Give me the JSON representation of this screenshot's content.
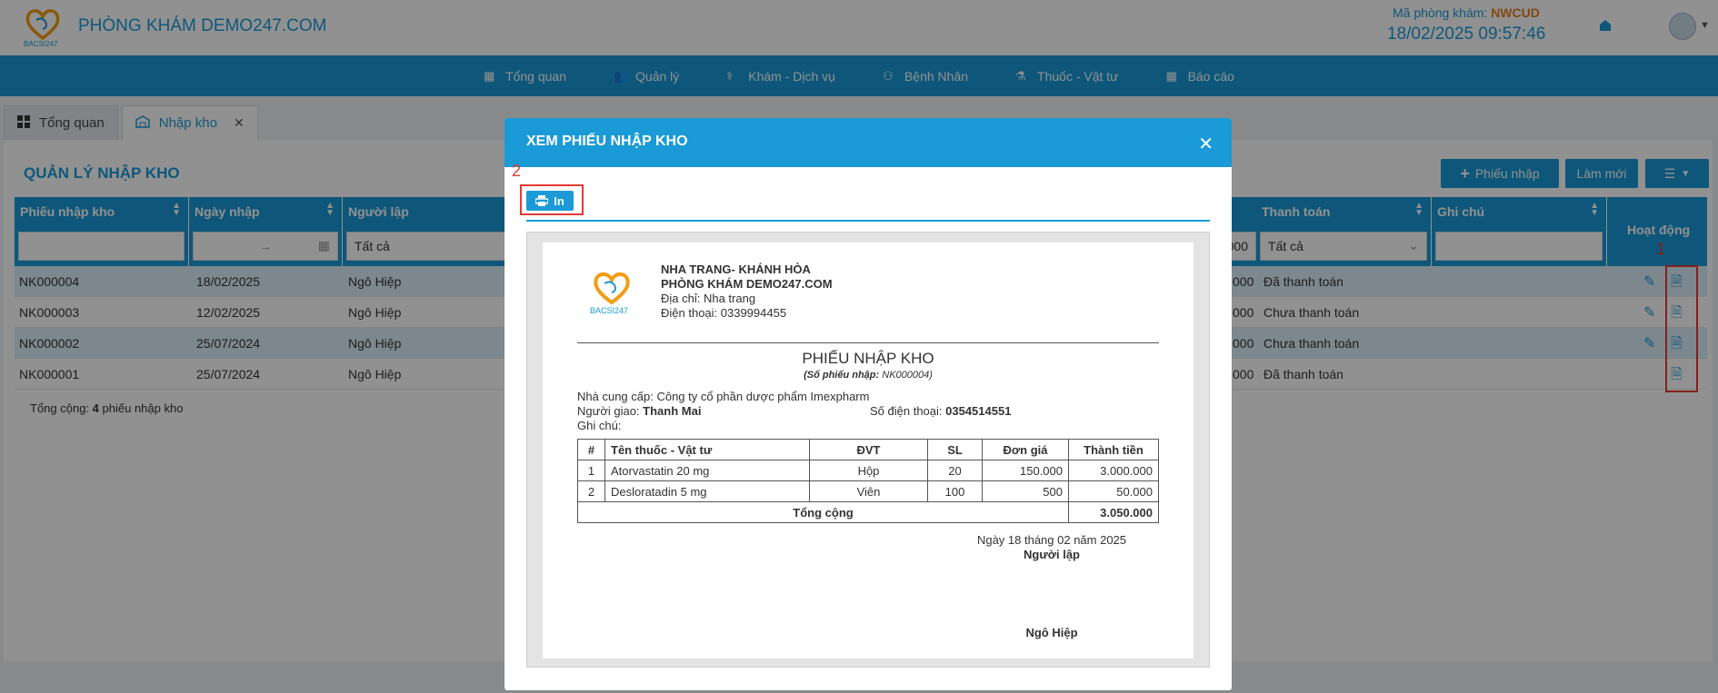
{
  "header": {
    "clinic_name": "PHÒNG KHÁM DEMO247.COM",
    "code_label": "Mã phòng khám:",
    "code_value": "NWCUD",
    "datetime": "18/02/2025 09:57:46",
    "logo_text": "BACSI247"
  },
  "nav": [
    {
      "label": "Tổng quan",
      "icon": "dashboard-icon"
    },
    {
      "label": "Quản lý",
      "icon": "users-icon"
    },
    {
      "label": "Khám - Dịch vụ",
      "icon": "doctor-icon"
    },
    {
      "label": "Bệnh Nhân",
      "icon": "patient-icon"
    },
    {
      "label": "Thuốc - Vật tư",
      "icon": "medicine-icon"
    },
    {
      "label": "Báo cáo",
      "icon": "report-icon"
    }
  ],
  "tabs": [
    {
      "label": "Tổng quan"
    },
    {
      "label": "Nhập kho"
    }
  ],
  "page": {
    "title": "QUẢN LÝ NHẬP KHO",
    "btn_add": "Phiếu nhập",
    "btn_refresh": "Làm mới"
  },
  "grid": {
    "headers": {
      "code": "Phiếu nhập kho",
      "date": "Ngày nhập",
      "creator": "Người lập",
      "amount_tail": "000",
      "payment": "Thanh toán",
      "note": "Ghi chú",
      "actions": "Hoạt động"
    },
    "filters": {
      "date_sep": "→",
      "creator": "Tất cả",
      "payment": "Tất cả"
    },
    "rows": [
      {
        "code": "NK000004",
        "date": "18/02/2025",
        "creator": "Ngô Hiệp",
        "amount_tail": "000",
        "payment": "Đã thanh toán"
      },
      {
        "code": "NK000003",
        "date": "12/02/2025",
        "creator": "Ngô Hiệp",
        "amount_tail": "000",
        "payment": "Chưa thanh toán"
      },
      {
        "code": "NK000002",
        "date": "25/07/2024",
        "creator": "Ngô Hiệp",
        "amount_tail": "000",
        "payment": "Chưa thanh toán"
      },
      {
        "code": "NK000001",
        "date": "25/07/2024",
        "creator": "Ngô Hiệp",
        "amount_tail": "000",
        "payment": "Đã thanh toán"
      }
    ],
    "total_prefix": "Tổng cộng:",
    "total_count": "4",
    "total_suffix": "phiếu nhập kho"
  },
  "annotations": {
    "one": "1",
    "two": "2"
  },
  "modal": {
    "title": "XEM PHIẾU NHẬP KHO",
    "print_label": "In",
    "doc": {
      "region": "NHA TRANG- KHÁNH HÒA",
      "clinic": "PHÒNG KHÁM DEMO247.COM",
      "address": "Địa chỉ: Nha trang",
      "phone": "Điện thoại: 0339994455",
      "title": "PHIẾU NHẬP KHO",
      "number_label": "(Số phiếu nhập:",
      "number_value": "NK000004)",
      "supplier": "Nhà cung cấp: Công ty cổ phần dược phẩm Imexpharm",
      "deliverer_label": "Người giao:",
      "deliverer": "Thanh Mai",
      "phone2_label": "Số điện thoại:",
      "phone2": "0354514551",
      "note_label": "Ghi chú:",
      "table_headers": [
        "#",
        "Tên thuốc - Vật tư",
        "ĐVT",
        "SL",
        "Đơn giá",
        "Thành tiền"
      ],
      "items": [
        {
          "no": "1",
          "name": "Atorvastatin 20 mg",
          "unit": "Hộp",
          "qty": "20",
          "price": "150.000",
          "total": "3.000.000"
        },
        {
          "no": "2",
          "name": "Desloratadin 5 mg",
          "unit": "Viên",
          "qty": "100",
          "price": "500",
          "total": "50.000"
        }
      ],
      "sum_label": "Tổng cộng",
      "sum_value": "3.050.000",
      "date_line": "Ngày 18 tháng 02 năm 2025",
      "signer_title": "Người lập",
      "signer_name": "Ngô Hiệp"
    }
  }
}
